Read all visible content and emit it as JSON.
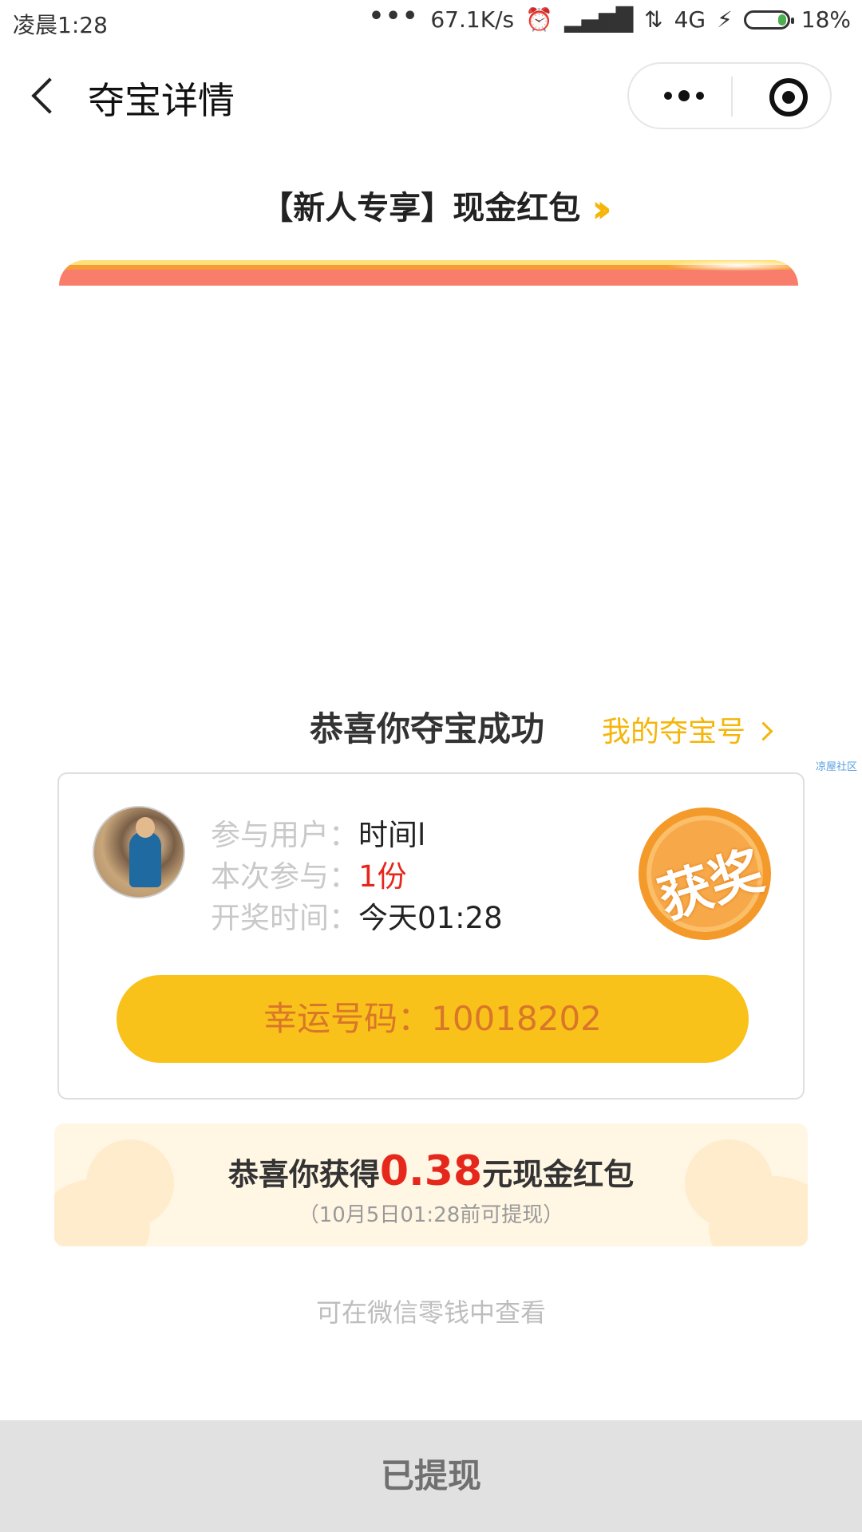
{
  "status_bar": {
    "time": "凌晨1:28",
    "dots": "•••",
    "net_speed": "67.1K/s",
    "network": "4G",
    "battery": "18%"
  },
  "nav": {
    "title": "夺宝详情"
  },
  "product": {
    "title": "【新人专享】现金红包"
  },
  "result": {
    "success_title": "恭喜你夺宝成功",
    "my_codes_link": "我的夺宝号",
    "watermark": "凉屋社区"
  },
  "card": {
    "user_label": "参与用户：",
    "user_value": "时间l",
    "count_label": "本次参与：",
    "count_value": "1份",
    "time_label": "开奖时间：",
    "time_value": "今天01:28",
    "badge_text": "获奖",
    "lucky_label": "幸运号码：",
    "lucky_code": "10018202"
  },
  "reward": {
    "prefix": "恭喜你获得",
    "amount": "0.38",
    "suffix": "元现金红包",
    "deadline": "（10月5日01:28前可提现）"
  },
  "hint": "可在微信零钱中查看",
  "bottom_button": "已提现"
}
